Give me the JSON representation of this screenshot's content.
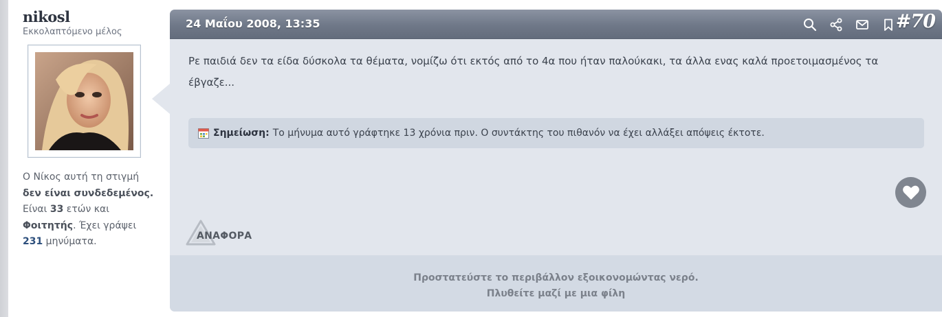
{
  "user": {
    "username": "nikosl",
    "usertitle": "Εκκολαπτόμενο μέλος",
    "info_line1": "Ο Νίκος αυτή τη στιγμή",
    "info_status": "δεν είναι συνδεδεμένος.",
    "info_age_prefix": "Είναι ",
    "info_age": "33",
    "info_age_suffix": " ετών και",
    "info_role": "Φοιτητής",
    "info_role_suffix": ". Έχει γράψει",
    "info_posts": "231",
    "info_posts_suffix": " μηνύματα."
  },
  "post": {
    "date": "24 Μαΐου 2008, 13:35",
    "number": "#70",
    "body": "Ρε παιδιά δεν τα είδα δύσκολα τα θέματα, νομίζω ότι εκτός από το 4α που ήταν παλούκακι, τα άλλα ενας καλά προετοιμασμένος τα έβγαζε...",
    "note_label": "Σημείωση:",
    "note_text": "Το μήνυμα αυτό γράφτηκε 13 χρόνια πριν. Ο συντάκτης του πιθανόν να έχει αλλάξει απόψεις έκτοτε.",
    "report_label": "ΑΝΑΦΟΡΑ",
    "footer_line1": "Προστατεύστε το περιβάλλον εξοικονομώντας νερό.",
    "footer_line2": "Πλυθείτε μαζί με μια φίλη"
  },
  "header_icons": [
    "search-icon",
    "share-icon",
    "mail-icon",
    "bookmark-icon"
  ],
  "colors": {
    "header_top": "#8b93a2",
    "header_bottom": "#636c7c",
    "post_bg": "#e2e6ed",
    "note_bg": "#d0d7e1",
    "footer_bg": "#d3dae4",
    "link": "#2d4f7c"
  }
}
